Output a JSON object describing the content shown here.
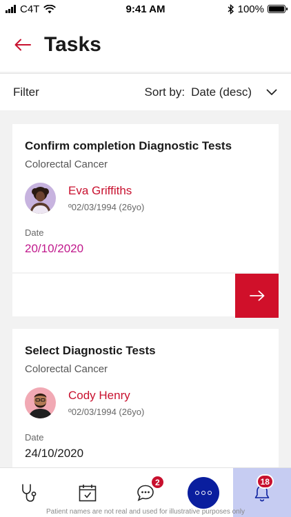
{
  "status_bar": {
    "carrier": "C4T",
    "time": "9:41 AM",
    "battery": "100%"
  },
  "header": {
    "title": "Tasks"
  },
  "filter_bar": {
    "filter_label": "Filter",
    "sort_label": "Sort by:",
    "sort_value": "Date (desc)"
  },
  "tasks": [
    {
      "title": "Confirm completion Diagnostic Tests",
      "subtitle": "Colorectal Cancer",
      "patient_name": "Eva Griffiths",
      "patient_dob": "º02/03/1994 (26yo)",
      "date_label": "Date",
      "date_value": "20/10/2020"
    },
    {
      "title": "Select Diagnostic Tests",
      "subtitle": "Colorectal Cancer",
      "patient_name": "Cody Henry",
      "patient_dob": "º02/03/1994 (26yo)",
      "date_label": "Date",
      "date_value": "24/10/2020"
    }
  ],
  "bottom_nav": {
    "items": [
      {
        "icon": "stethoscope-icon"
      },
      {
        "icon": "calendar-check-icon"
      },
      {
        "icon": "chat-icon",
        "badge": "2"
      },
      {
        "icon": "more-icon"
      },
      {
        "icon": "bell-icon",
        "badge": "18",
        "active": true
      }
    ],
    "disclaimer": "Patient names are not real and used for illustrative purposes only"
  },
  "colors": {
    "accent_red": "#c8102e",
    "date_magenta": "#c0188c",
    "nav_blue": "#0a1e9e",
    "active_tab": "#c6ccf2"
  }
}
